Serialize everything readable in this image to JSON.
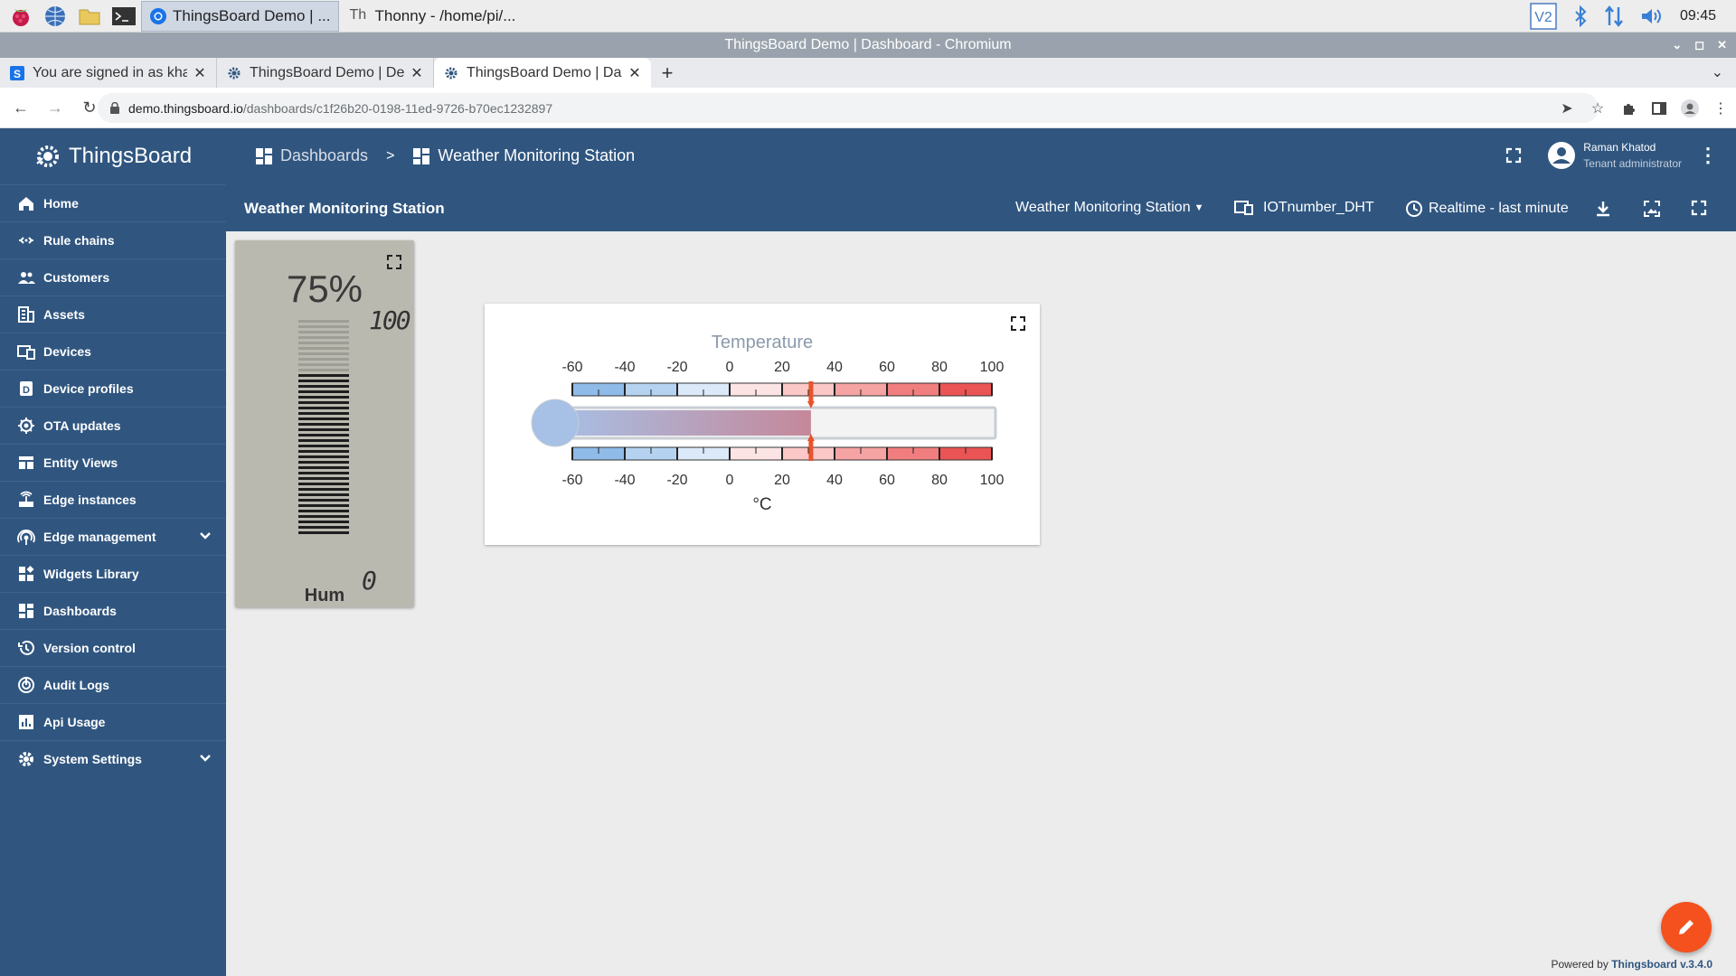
{
  "taskbar": {
    "tasks": [
      {
        "label": "ThingsBoard Demo | ...",
        "active": true
      },
      {
        "label": "Thonny  -  /home/pi/...",
        "active": false
      }
    ],
    "clock": "09:45"
  },
  "window": {
    "title": "ThingsBoard Demo | Dashboard - Chromium"
  },
  "browser": {
    "tabs": [
      {
        "label": "You are signed in as kha",
        "favicon": "s-icon"
      },
      {
        "label": "ThingsBoard Demo | Dev",
        "favicon": "gear-icon"
      },
      {
        "label": "ThingsBoard Demo | Das",
        "favicon": "gear-icon",
        "active": true
      }
    ],
    "url_host": "demo.thingsboard.io",
    "url_path": "/dashboards/c1f26b20-0198-11ed-9726-b70ec1232897"
  },
  "sidebar": {
    "logo": "ThingsBoard",
    "items": [
      {
        "label": "Home",
        "icon": "home-icon"
      },
      {
        "label": "Rule chains",
        "icon": "rule-chain-icon"
      },
      {
        "label": "Customers",
        "icon": "customers-icon"
      },
      {
        "label": "Assets",
        "icon": "assets-icon"
      },
      {
        "label": "Devices",
        "icon": "devices-icon"
      },
      {
        "label": "Device profiles",
        "icon": "device-profiles-icon"
      },
      {
        "label": "OTA updates",
        "icon": "ota-icon"
      },
      {
        "label": "Entity Views",
        "icon": "entity-views-icon"
      },
      {
        "label": "Edge instances",
        "icon": "edge-icon"
      },
      {
        "label": "Edge management",
        "icon": "edge-management-icon",
        "expandable": true
      },
      {
        "label": "Widgets Library",
        "icon": "widgets-icon"
      },
      {
        "label": "Dashboards",
        "icon": "dashboards-icon"
      },
      {
        "label": "Version control",
        "icon": "history-icon"
      },
      {
        "label": "Audit Logs",
        "icon": "audit-icon"
      },
      {
        "label": "Api Usage",
        "icon": "api-usage-icon"
      },
      {
        "label": "System Settings",
        "icon": "settings-icon",
        "expandable": true
      }
    ]
  },
  "header": {
    "breadcrumb_root": "Dashboards",
    "breadcrumb_sep": ">",
    "breadcrumb_current": "Weather Monitoring Station",
    "user_name": "Raman Khatod",
    "user_role": "Tenant administrator"
  },
  "toolbar": {
    "dashboard_title": "Weather Monitoring Station",
    "state_select": "Weather Monitoring Station",
    "entity_alias": "IOTnumber_DHT",
    "timewindow": "Realtime - last minute"
  },
  "widgets": {
    "humidity": {
      "value": "75%",
      "max_label": "100",
      "min_label": "0",
      "label": "Hum",
      "level": 0.75
    },
    "temperature": {
      "title": "Temperature",
      "unit": "°C",
      "min": -60,
      "max": 100,
      "value": 31,
      "ticks": [
        "-60",
        "-40",
        "-20",
        "0",
        "20",
        "40",
        "60",
        "80",
        "100"
      ]
    }
  },
  "footer": {
    "powered_by": "Powered by ",
    "version_link": "Thingsboard v.3.4.0"
  },
  "colors": {
    "primary": "#305680",
    "accent": "#f4511e"
  }
}
